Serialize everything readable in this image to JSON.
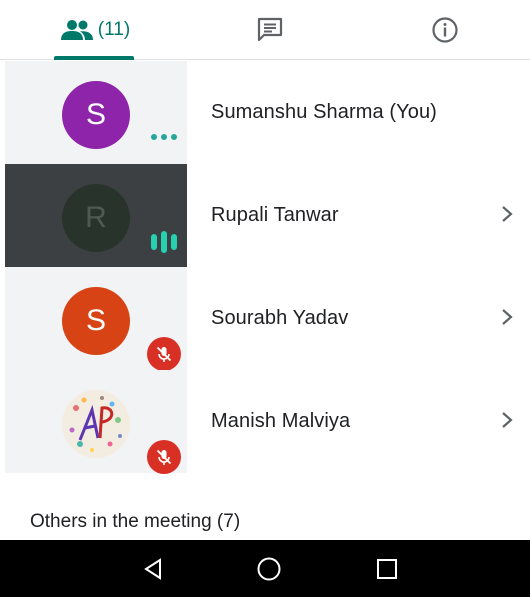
{
  "tabs": {
    "people_count": "(11)",
    "people_icon": "people-icon",
    "chat_icon": "chat-icon",
    "info_icon": "info-icon",
    "accent": "#00796b"
  },
  "participants": [
    {
      "initial": "S",
      "name": "Sumanshu Sharma (You)",
      "avatar_color": "#8e24aa",
      "status": "more-dots",
      "has_chevron": false
    },
    {
      "initial": "R",
      "name": "Rupali Tanwar",
      "avatar_color": "#27332b",
      "status": "speaking-bars",
      "has_chevron": true
    },
    {
      "initial": "S",
      "name": "Sourabh Yadav",
      "avatar_color": "#d84315",
      "status": "muted",
      "has_chevron": true
    },
    {
      "initial": "",
      "name": "Manish Malviya",
      "avatar_color": "#f5efe6",
      "status": "muted",
      "has_chevron": true
    }
  ],
  "section": {
    "others_label": "Others in the meeting (7)"
  },
  "navbar": {
    "back_icon": "back-triangle-icon",
    "home_icon": "home-circle-icon",
    "recents_icon": "recents-square-icon"
  }
}
